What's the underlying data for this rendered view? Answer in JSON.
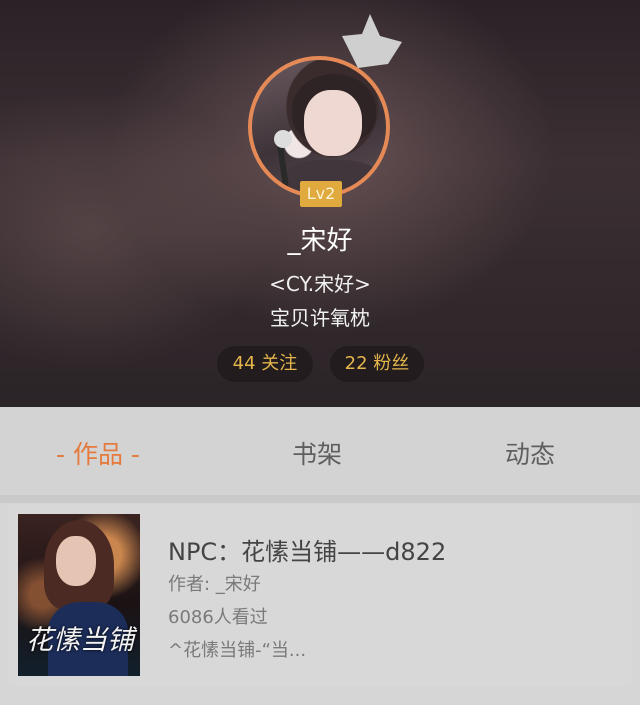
{
  "profile": {
    "level": "Lv2",
    "username": "_宋好",
    "signature_line1": "<CY.宋好>",
    "signature_line2": "宝贝许氧枕",
    "following": "44 关注",
    "followers": "22 粉丝"
  },
  "tabs": [
    {
      "label": "- 作品 -",
      "active": true
    },
    {
      "label": "书架",
      "active": false
    },
    {
      "label": "动态",
      "active": false
    }
  ],
  "works": [
    {
      "cover_text": "花愫当铺",
      "title": "NPC：花愫当铺——d822",
      "author": "作者: _宋好",
      "views": "6086人看过",
      "excerpt": "^花愫当铺-“当..."
    }
  ],
  "colors": {
    "accent_orange": "#e47a3d",
    "stat_gold": "#e3b54a",
    "level_badge": "#e0aa3e",
    "avatar_ring": "#e58a56"
  },
  "icons": [
    "crown-icon"
  ]
}
